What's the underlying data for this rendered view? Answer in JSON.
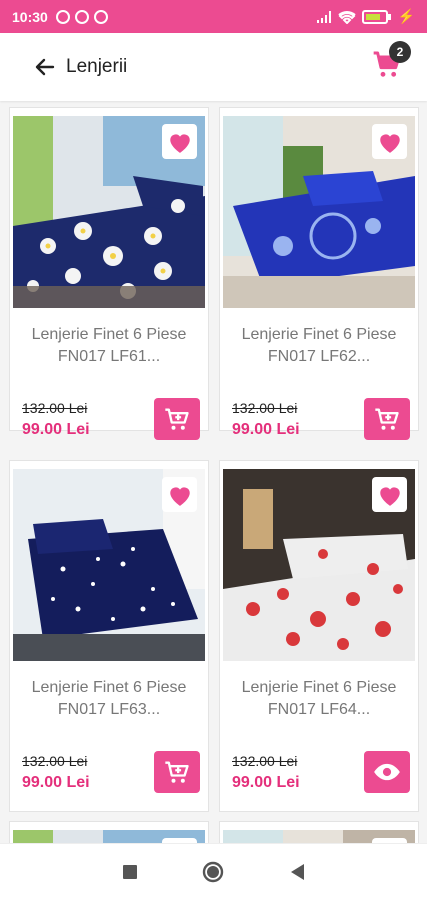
{
  "status_bar": {
    "time": "10:30",
    "battery": "⚡"
  },
  "app_bar": {
    "title": "Lenjerii",
    "cart_count": "2"
  },
  "products": [
    {
      "name_line1": "Lenjerie Finet 6 Piese",
      "name_line2": "FN017 LF61...",
      "old_price": "132.00 Lei",
      "new_price": "99.00 Lei",
      "action": "add-to-cart"
    },
    {
      "name_line1": "Lenjerie Finet 6 Piese",
      "name_line2": "FN017  LF62...",
      "old_price": "132.00 Lei",
      "new_price": "99.00 Lei",
      "action": "add-to-cart"
    },
    {
      "name_line1": "Lenjerie Finet 6 Piese",
      "name_line2": "FN017   LF63...",
      "old_price": "132.00 Lei",
      "new_price": "99.00 Lei",
      "action": "add-to-cart"
    },
    {
      "name_line1": "Lenjerie Finet 6 Piese",
      "name_line2": "FN017    LF64...",
      "old_price": "132.00 Lei",
      "new_price": "99.00 Lei",
      "action": "view"
    }
  ],
  "colors": {
    "accent": "#ec4b91",
    "price": "#e42f7b"
  }
}
